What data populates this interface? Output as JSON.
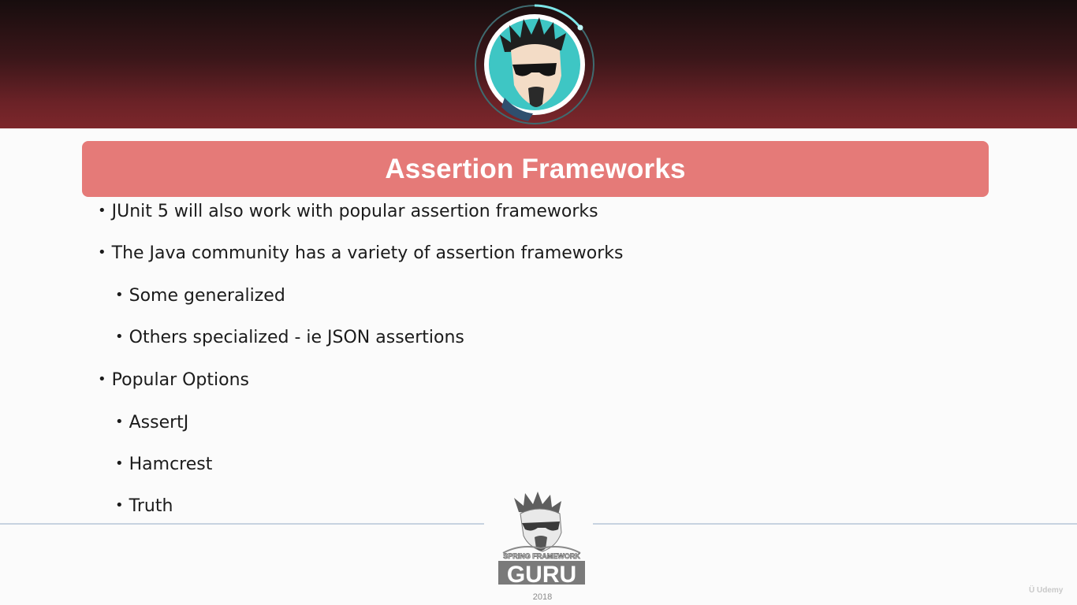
{
  "slide": {
    "title": "Assertion Frameworks",
    "bullets": [
      {
        "level": 1,
        "text": "JUnit 5 will also work with popular assertion frameworks"
      },
      {
        "level": 1,
        "text": "The Java community has a variety of assertion frameworks"
      },
      {
        "level": 2,
        "text": "Some generalized"
      },
      {
        "level": 2,
        "text": "Others specialized - ie JSON assertions"
      },
      {
        "level": 1,
        "text": "Popular Options"
      },
      {
        "level": 2,
        "text": "AssertJ"
      },
      {
        "level": 2,
        "text": "Hamcrest"
      },
      {
        "level": 2,
        "text": "Truth"
      }
    ],
    "bullet_symbol": "•"
  },
  "logo": {
    "tagline": "SPRING FRAMEWORK",
    "name": "GURU",
    "year": "2018"
  },
  "watermark": {
    "text": "Udemy"
  },
  "colors": {
    "title_bar": "#e57a78",
    "header_dark": "#170d0e",
    "header_red": "#7d272b",
    "avatar_bg": "#3ec6c4",
    "divider": "#c7d3e0"
  },
  "icons": {
    "avatar": "instructor-avatar-icon",
    "logo": "spring-framework-guru-logo-icon"
  }
}
